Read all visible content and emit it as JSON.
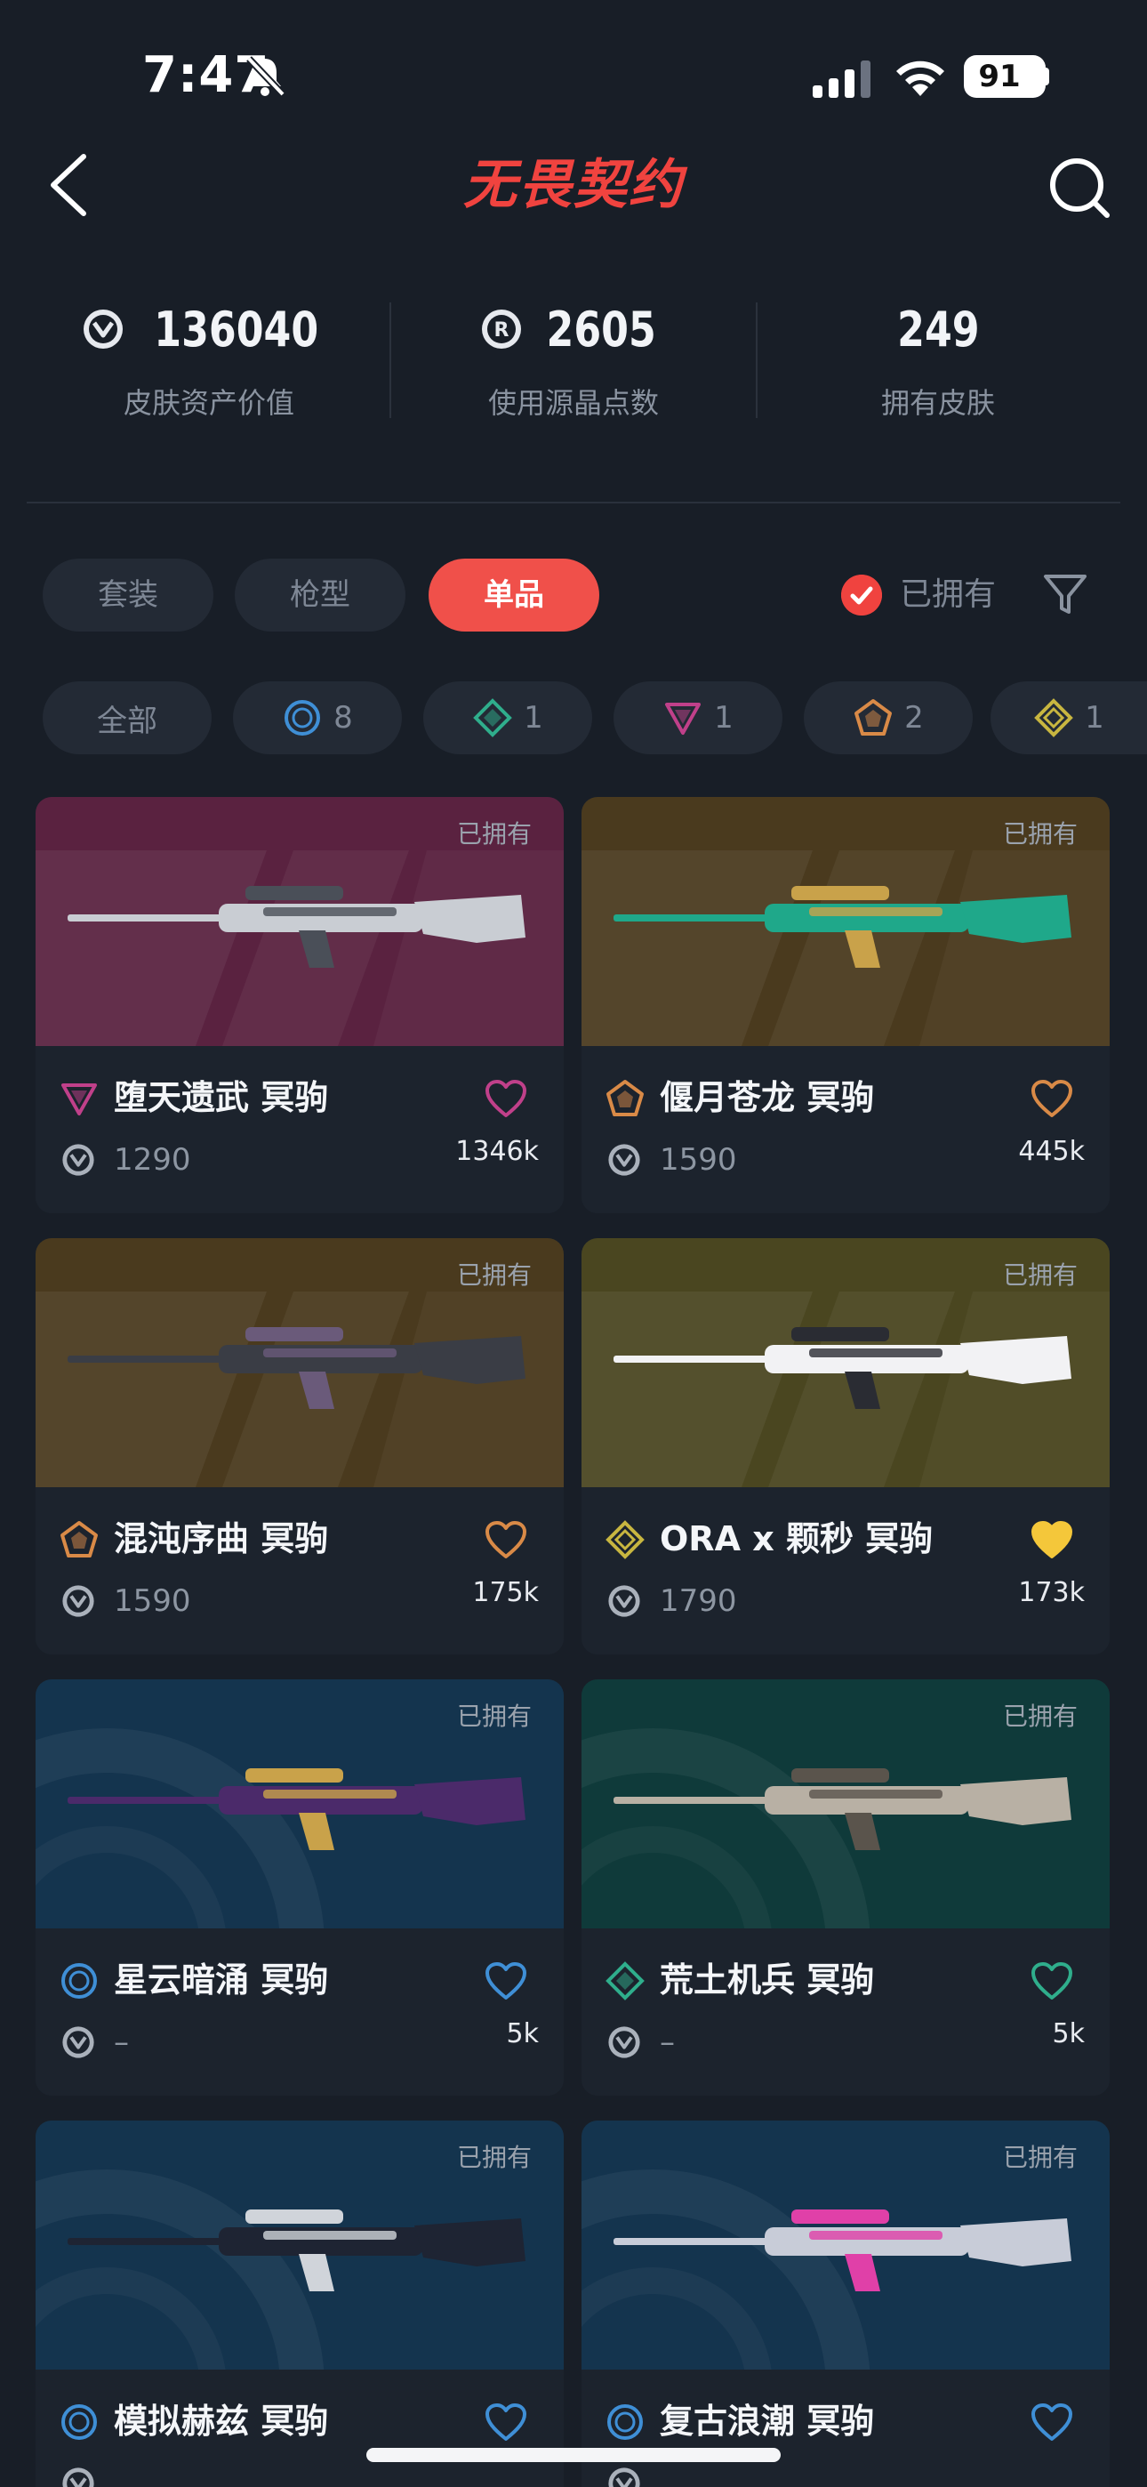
{
  "status_bar": {
    "time": "7:47",
    "battery": "91"
  },
  "header": {
    "logo_text": "无畏契约"
  },
  "stats": [
    {
      "value": "136040",
      "label": "皮肤资产价值",
      "icon": "vp-coin-icon"
    },
    {
      "value": "2605",
      "label": "使用源晶点数",
      "icon": "radianite-icon"
    },
    {
      "value": "249",
      "label": "拥有皮肤",
      "icon": ""
    }
  ],
  "tabs": [
    {
      "label": "套装",
      "active": false
    },
    {
      "label": "枪型",
      "active": false
    },
    {
      "label": "单品",
      "active": true
    }
  ],
  "owned_filter": {
    "label": "已拥有",
    "checked": true
  },
  "tier_chips": [
    {
      "label": "全部",
      "count": ""
    },
    {
      "label": "",
      "count": "8",
      "tier": "select",
      "color": "#3f8fd6"
    },
    {
      "label": "",
      "count": "1",
      "tier": "deluxe",
      "color": "#2fae8c"
    },
    {
      "label": "",
      "count": "1",
      "tier": "premium",
      "color": "#c0408a"
    },
    {
      "label": "",
      "count": "2",
      "tier": "ultra",
      "color": "#d98a47"
    },
    {
      "label": "",
      "count": "1",
      "tier": "exclusive",
      "color": "#c8b640"
    }
  ],
  "cards": [
    {
      "owned": "已拥有",
      "name": "堕天遗武 冥驹",
      "price": "1290",
      "likes": "1346k",
      "tier": "premium",
      "tier_color": "#c0408a",
      "heart_color": "#c0408a",
      "heart_filled": false,
      "bg": "#5a2240"
    },
    {
      "owned": "已拥有",
      "name": "偃月苍龙 冥驹",
      "price": "1590",
      "likes": "445k",
      "tier": "ultra",
      "tier_color": "#d98a47",
      "heart_color": "#d98a47",
      "heart_filled": false,
      "bg": "#4a3a1e"
    },
    {
      "owned": "已拥有",
      "name": "混沌序曲 冥驹",
      "price": "1590",
      "likes": "175k",
      "tier": "ultra",
      "tier_color": "#d98a47",
      "heart_color": "#d98a47",
      "heart_filled": false,
      "bg": "#4a3a1e"
    },
    {
      "owned": "已拥有",
      "name": "ORA x 颗秒 冥驹",
      "price": "1790",
      "likes": "173k",
      "tier": "exclusive",
      "tier_color": "#c8b640",
      "heart_color": "#f4c73a",
      "heart_filled": true,
      "bg": "#4a4620"
    },
    {
      "owned": "已拥有",
      "name": "星云暗涌 冥驹",
      "price": "–",
      "likes": "5k",
      "tier": "select",
      "tier_color": "#3f8fd6",
      "heart_color": "#3f8fd6",
      "heart_filled": false,
      "bg": "#14344e"
    },
    {
      "owned": "已拥有",
      "name": "荒土机兵 冥驹",
      "price": "–",
      "likes": "5k",
      "tier": "deluxe",
      "tier_color": "#2fae8c",
      "heart_color": "#2fae8c",
      "heart_filled": false,
      "bg": "#0f3a3a"
    },
    {
      "owned": "已拥有",
      "name": "模拟赫兹 冥驹",
      "price": "",
      "likes": "",
      "tier": "select",
      "tier_color": "#3f8fd6",
      "heart_color": "#3f8fd6",
      "heart_filled": false,
      "bg": "#14344e"
    },
    {
      "owned": "已拥有",
      "name": "复古浪潮 冥驹",
      "price": "",
      "likes": "",
      "tier": "select",
      "tier_color": "#3f8fd6",
      "heart_color": "#3f8fd6",
      "heart_filled": false,
      "bg": "#14344e"
    }
  ]
}
